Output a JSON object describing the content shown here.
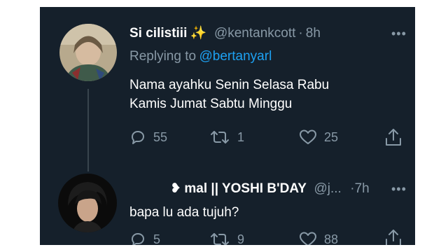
{
  "colors": {
    "background": "#15202b",
    "text_primary": "#ffffff",
    "text_secondary": "#8899a6",
    "link": "#1da1f2",
    "thread_line": "#38444d"
  },
  "tweets": [
    {
      "display_name": "Si cilistiii",
      "name_emoji": "✨",
      "handle": "@kentankcott",
      "separator": "·",
      "time": "8h",
      "replying_prefix": "Replying to",
      "replying_to": "@bertanyarl",
      "text_lines": [
        "Nama ayahku Senin Selasa Rabu",
        "Kamis Jumat Sabtu Minggu"
      ],
      "actions": {
        "replies": "55",
        "retweets": "1",
        "likes": "25"
      },
      "more_icon": "more-horizontal-icon"
    },
    {
      "name_prefix": "❥",
      "display_name": "mal || YOSHI B'DAY",
      "handle": "@j...",
      "separator": "·",
      "time": "7h",
      "text_lines": [
        "bapa lu ada tujuh?"
      ],
      "actions": {
        "replies": "5",
        "retweets": "9",
        "likes": "88"
      },
      "more_icon": "more-horizontal-icon"
    }
  ]
}
